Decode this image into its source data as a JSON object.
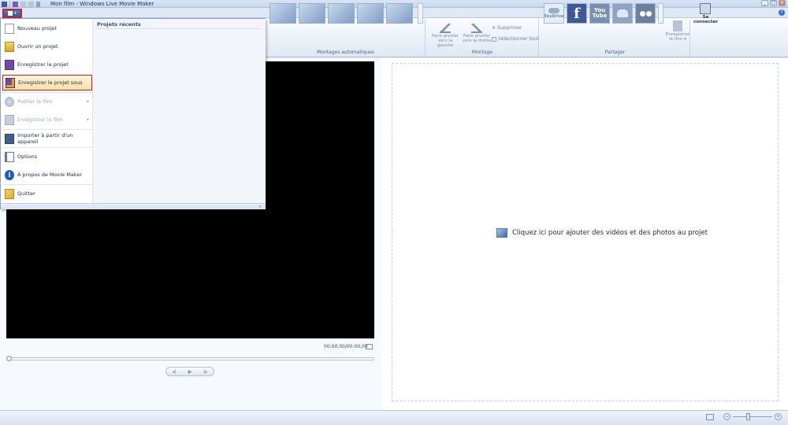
{
  "window": {
    "title": "Mon film - Windows Live Movie Maker",
    "controls": [
      "_",
      "□",
      "✕"
    ]
  },
  "ribbon": {
    "groups": {
      "auto_movie": "Montages automatiques",
      "editing": "Montage",
      "share": "Partager"
    },
    "editing": {
      "rotate_left_1": "Faire pivoter",
      "rotate_left_2": "vers la gauche",
      "rotate_right_1": "Faire pivoter",
      "rotate_right_2": "vers la droite",
      "delete": "Supprimer",
      "select_all": "Sélectionner tout"
    },
    "share": {
      "skydrive": "SkyDrive",
      "facebook": "f",
      "youtube_1": "You",
      "youtube_2": "Tube",
      "save_film_1": "Enregistrer",
      "save_film_2": "le film ▾",
      "connect_1": "Se",
      "connect_2": "connecter"
    },
    "accent_color": "#2b5aa0"
  },
  "file_menu": {
    "recent_title": "Projets récents",
    "items": [
      {
        "label": "Nouveau projet",
        "icon": "new-project-icon",
        "enabled": true,
        "highlighted": false
      },
      {
        "label": "Ouvrir un projet",
        "icon": "open-folder-icon",
        "enabled": true,
        "highlighted": false
      },
      {
        "label": "Enregistrer le projet",
        "icon": "save-icon",
        "enabled": true,
        "highlighted": false
      },
      {
        "label": "Enregistrer le projet sous",
        "icon": "save-as-icon",
        "enabled": true,
        "highlighted": true
      },
      {
        "label": "Publier le film",
        "icon": "publish-icon",
        "enabled": false,
        "submenu": true
      },
      {
        "label": "Enregistrer le film",
        "icon": "film-icon",
        "enabled": false,
        "submenu": true
      },
      {
        "label": "Importer à partir d'un appareil",
        "icon": "import-device-icon",
        "enabled": true
      },
      {
        "label": "Options",
        "icon": "options-icon",
        "enabled": true
      },
      {
        "label": "À propos de Movie Maker",
        "icon": "info-icon",
        "enabled": true
      },
      {
        "label": "Quitter",
        "icon": "quit-icon",
        "enabled": true
      }
    ],
    "submenu_arrow": "▸",
    "footer_arrow": "▾"
  },
  "player": {
    "timecode": "00:00,00/00:00,00",
    "prev": "◂|",
    "play": "▶",
    "next": "|▸"
  },
  "storyboard": {
    "hint": "Cliquez ici pour ajouter des vidéos et des photos au projet"
  },
  "statusbar": {
    "zoom_minus": "−",
    "zoom_plus": "+"
  }
}
